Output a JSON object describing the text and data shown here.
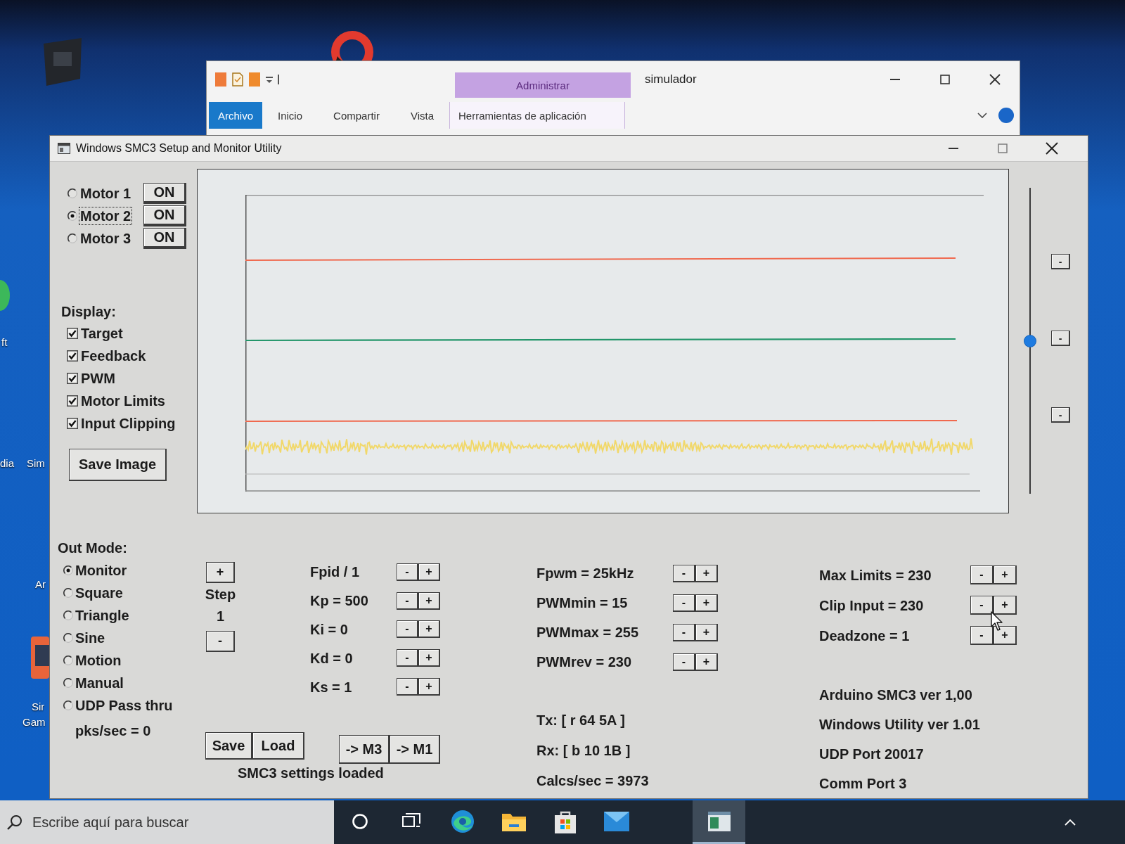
{
  "desktop": {
    "labels": [
      "ft",
      "dia",
      "Sim",
      "Ar",
      "Sir",
      "Gam"
    ]
  },
  "explorer_window": {
    "title": "simulador",
    "context_header": "Administrar",
    "tabs": [
      {
        "label": "Archivo",
        "kind": "file"
      },
      {
        "label": "Inicio",
        "kind": "tab"
      },
      {
        "label": "Compartir",
        "kind": "tab"
      },
      {
        "label": "Vista",
        "kind": "tab"
      },
      {
        "label": "Herramientas de aplicación",
        "kind": "context"
      }
    ]
  },
  "window": {
    "title": "Windows SMC3 Setup and Monitor Utility"
  },
  "motors": [
    {
      "label": "Motor 1",
      "selected": false,
      "button": "ON"
    },
    {
      "label": "Motor 2",
      "selected": true,
      "button": "ON"
    },
    {
      "label": "Motor 3",
      "selected": false,
      "button": "ON"
    }
  ],
  "display": {
    "label": "Display:",
    "items": [
      {
        "label": "Target",
        "checked": true
      },
      {
        "label": "Feedback",
        "checked": true
      },
      {
        "label": "PWM",
        "checked": true
      },
      {
        "label": "Motor Limits",
        "checked": true
      },
      {
        "label": "Input Clipping",
        "checked": true
      }
    ]
  },
  "save_image_button": "Save Image",
  "slider": {
    "level": 0.5
  },
  "side_buttons": [
    "-",
    "-",
    "-"
  ],
  "out_mode": {
    "label": "Out Mode:",
    "options": [
      {
        "label": "Monitor",
        "selected": true
      },
      {
        "label": "Square",
        "selected": false
      },
      {
        "label": "Triangle",
        "selected": false
      },
      {
        "label": "Sine",
        "selected": false
      },
      {
        "label": "Motion",
        "selected": false
      },
      {
        "label": "Manual",
        "selected": false
      },
      {
        "label": "UDP Pass thru",
        "selected": false
      }
    ],
    "packets": "pks/sec = 0"
  },
  "step": {
    "increase": "+",
    "label": "Step",
    "value": "1",
    "decrease": "-"
  },
  "pid_params": [
    {
      "label": "Fpid / 1",
      "minus": "-",
      "plus": "+"
    },
    {
      "label": "Kp = 500",
      "minus": "-",
      "plus": "+"
    },
    {
      "label": "Ki = 0",
      "minus": "-",
      "plus": "+"
    },
    {
      "label": "Kd = 0",
      "minus": "-",
      "plus": "+"
    },
    {
      "label": "Ks = 1",
      "minus": "-",
      "plus": "+"
    }
  ],
  "settings_buttons": [
    "Save",
    "Load"
  ],
  "copy_buttons": [
    "-> M3",
    "-> M1"
  ],
  "settings_status": "SMC3 settings loaded",
  "pwm_params": [
    {
      "label": "Fpwm = 25kHz",
      "minus": "-",
      "plus": "+"
    },
    {
      "label": "PWMmin = 15",
      "minus": "-",
      "plus": "+"
    },
    {
      "label": "PWMmax = 255",
      "minus": "-",
      "plus": "+"
    },
    {
      "label": "PWMrev = 230",
      "minus": "-",
      "plus": "+"
    }
  ],
  "comm": [
    "Tx: [ r 64 5A ]",
    "Rx: [ b 10 1B ]",
    "Calcs/sec = 3973"
  ],
  "limit_params": [
    {
      "label": "Max Limits = 230",
      "minus": "-",
      "plus": "+"
    },
    {
      "label": "Clip Input = 230",
      "minus": "-",
      "plus": "+"
    },
    {
      "label": "Deadzone = 1",
      "minus": "-",
      "plus": "+"
    }
  ],
  "info": [
    "Arduino SMC3 ver 1,00",
    "Windows Utility ver 1.01",
    "UDP Port 20017",
    "Comm Port 3"
  ],
  "taskbar": {
    "search_placeholder": "Escribe aquí para buscar",
    "apps": [
      {
        "selected": false
      },
      {
        "selected": false
      },
      {
        "selected": false
      },
      {
        "selected": false
      },
      {
        "selected": true
      }
    ]
  }
}
